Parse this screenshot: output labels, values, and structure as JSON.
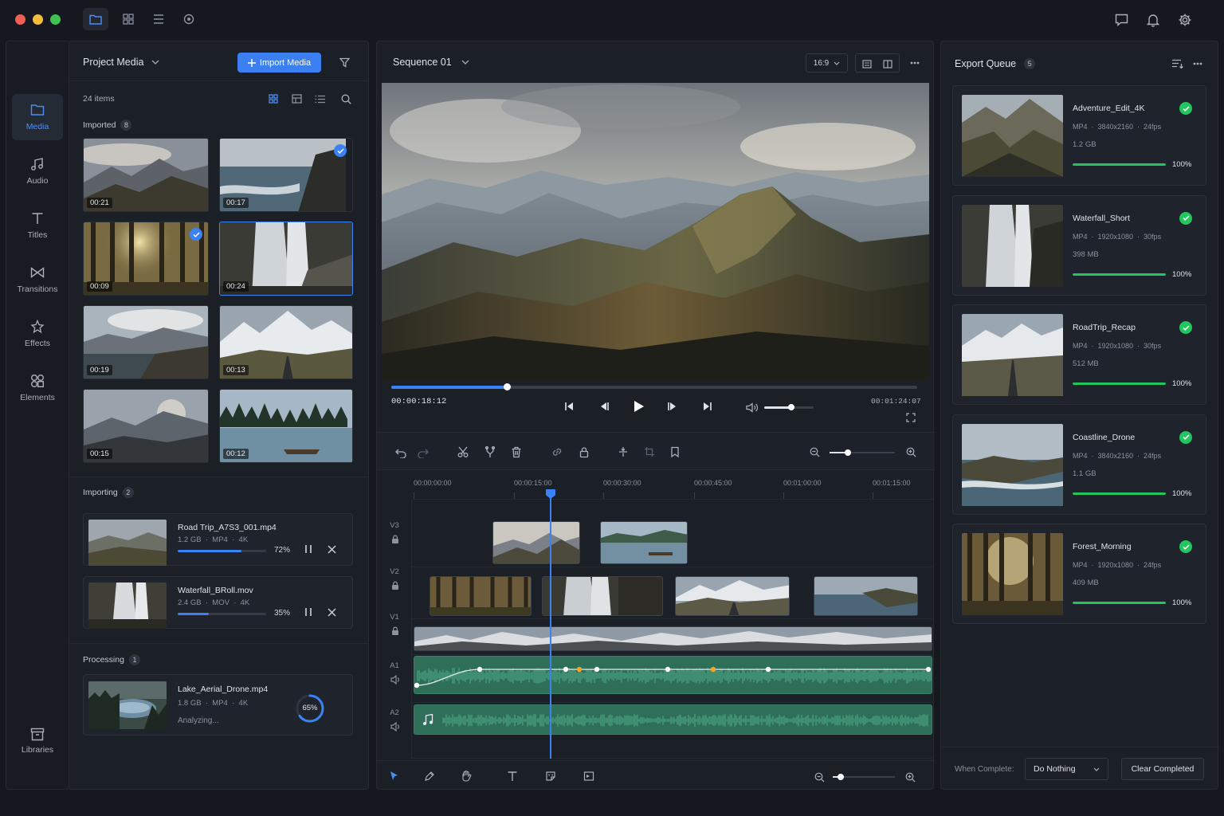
{
  "titlebar": {
    "toolbar_icons": [
      "folder-icon",
      "grid-icon",
      "list-icon",
      "record-icon"
    ],
    "right_icons": [
      "chat-icon",
      "bell-icon",
      "gear-icon"
    ]
  },
  "sidebar": {
    "items": [
      {
        "label": "Media",
        "icon": "folder-icon",
        "active": true
      },
      {
        "label": "Audio",
        "icon": "music-icon"
      },
      {
        "label": "Titles",
        "icon": "text-icon"
      },
      {
        "label": "Transitions",
        "icon": "bowtie-icon"
      },
      {
        "label": "Effects",
        "icon": "sparkle-icon"
      },
      {
        "label": "Elements",
        "icon": "shapes-icon"
      }
    ],
    "bottom": {
      "label": "Libraries",
      "icon": "archive-icon"
    }
  },
  "media": {
    "title": "Project Media",
    "import_label": "Import Media",
    "count": "24 items",
    "imported": {
      "label": "Imported",
      "count": "8",
      "items": [
        {
          "duration": "00:21",
          "checked": false
        },
        {
          "duration": "00:17",
          "checked": true
        },
        {
          "duration": "00:09",
          "checked": true
        },
        {
          "duration": "00:24",
          "checked": false,
          "selected": true
        },
        {
          "duration": "00:19",
          "checked": false
        },
        {
          "duration": "00:13",
          "checked": false
        },
        {
          "duration": "00:15",
          "checked": false
        },
        {
          "duration": "00:12",
          "checked": false
        }
      ]
    },
    "importing": {
      "label": "Importing",
      "count": "2",
      "items": [
        {
          "name": "Road Trip_A7S3_001.mp4",
          "meta": "1.2 GB  ·  MP4  ·  4K",
          "progress": 72,
          "percent": "72%"
        },
        {
          "name": "Waterfall_BRoll.mov",
          "meta": "2.4 GB  ·  MOV  ·  4K",
          "progress": 35,
          "percent": "35%"
        }
      ]
    },
    "processing": {
      "label": "Processing",
      "count": "1",
      "items": [
        {
          "name": "Lake_Aerial_Drone.mp4",
          "meta": "1.8 GB  ·  MP4  ·  4K",
          "status": "Analyzing...",
          "progress": 65,
          "percent": "65%"
        }
      ]
    }
  },
  "viewer": {
    "sequence": "Sequence 01",
    "aspect": "16:9",
    "current_time": "00:00:18:12",
    "total_time": "00:01:24:07",
    "playhead_fraction": 0.22,
    "volume_fraction": 0.55
  },
  "timeline": {
    "ruler": [
      "00:00:00:00",
      "00:00:15:00",
      "00:00:30:00",
      "00:00:45:00",
      "00:01:00:00",
      "00:01:15:00"
    ],
    "tracks": [
      "V3",
      "V2",
      "V1",
      "A1",
      "A2"
    ]
  },
  "export": {
    "title": "Export Queue",
    "count": "5",
    "items": [
      {
        "name": "Adventure_Edit_4K",
        "meta": "MP4  ·  3840x2160  ·  24fps",
        "size": "1.2 GB",
        "percent": "100%",
        "progress": 100
      },
      {
        "name": "Waterfall_Short",
        "meta": "MP4  ·  1920x1080  ·  30fps",
        "size": "398 MB",
        "percent": "100%",
        "progress": 100
      },
      {
        "name": "RoadTrip_Recap",
        "meta": "MP4  ·  1920x1080  ·  30fps",
        "size": "512 MB",
        "percent": "100%",
        "progress": 100
      },
      {
        "name": "Coastline_Drone",
        "meta": "MP4  ·  3840x2160  ·  24fps",
        "size": "1.1 GB",
        "percent": "100%",
        "progress": 100
      },
      {
        "name": "Forest_Morning",
        "meta": "MP4  ·  1920x1080  ·  24fps",
        "size": "409 MB",
        "percent": "100%",
        "progress": 100
      }
    ],
    "when_complete_label": "When Complete:",
    "when_complete_value": "Do Nothing",
    "clear_label": "Clear Completed"
  },
  "colors": {
    "accent": "#3b82f6",
    "success": "#22c55e",
    "audio": "#2f7d63"
  }
}
